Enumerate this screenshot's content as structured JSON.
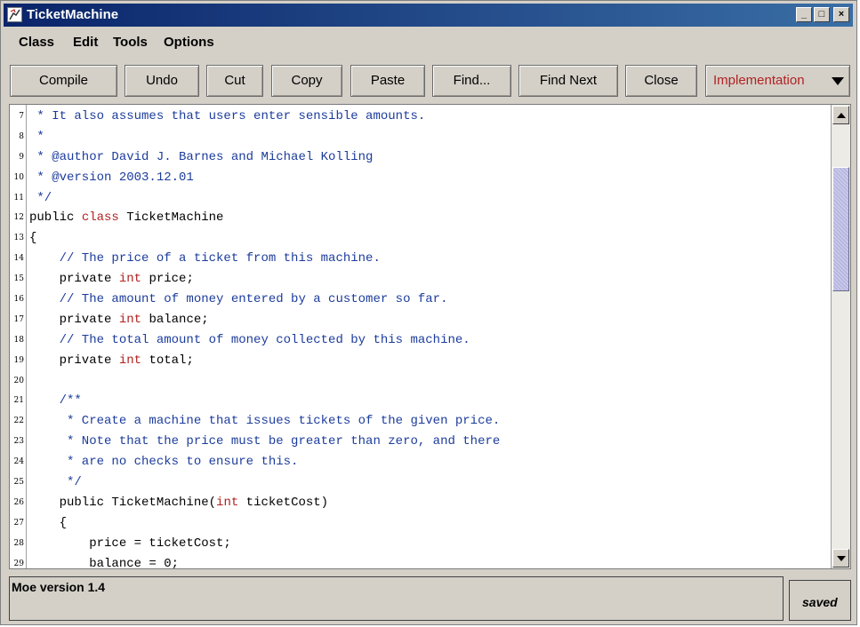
{
  "window": {
    "title": "TicketMachine",
    "controls": {
      "minimize": "_",
      "maximize": "□",
      "close": "×"
    }
  },
  "menubar": {
    "items": [
      "Class",
      "Edit",
      "Tools",
      "Options"
    ]
  },
  "toolbar": {
    "buttons": [
      "Compile",
      "Undo",
      "Cut",
      "Copy",
      "Paste",
      "Find...",
      "Find Next",
      "Close"
    ],
    "view_select": "Implementation"
  },
  "editor": {
    "lines": [
      {
        "n": "7",
        "segments": [
          {
            "t": "c",
            "v": " * It also assumes that users enter sensible amounts."
          }
        ]
      },
      {
        "n": "8",
        "segments": [
          {
            "t": "c",
            "v": " *"
          }
        ]
      },
      {
        "n": "9",
        "segments": [
          {
            "t": "c",
            "v": " * @author David J. Barnes and Michael Kolling"
          }
        ]
      },
      {
        "n": "10",
        "segments": [
          {
            "t": "c",
            "v": " * @version 2003.12.01"
          }
        ]
      },
      {
        "n": "11",
        "segments": [
          {
            "t": "c",
            "v": " */"
          }
        ]
      },
      {
        "n": "12",
        "segments": [
          {
            "t": "t",
            "v": "public "
          },
          {
            "t": "k",
            "v": "class"
          },
          {
            "t": "t",
            "v": " TicketMachine"
          }
        ]
      },
      {
        "n": "13",
        "segments": [
          {
            "t": "t",
            "v": "{"
          }
        ]
      },
      {
        "n": "14",
        "segments": [
          {
            "t": "c",
            "v": "    // The price of a ticket from this machine."
          }
        ]
      },
      {
        "n": "15",
        "segments": [
          {
            "t": "t",
            "v": "    private "
          },
          {
            "t": "k",
            "v": "int"
          },
          {
            "t": "t",
            "v": " price;"
          }
        ]
      },
      {
        "n": "16",
        "segments": [
          {
            "t": "c",
            "v": "    // The amount of money entered by a customer so far."
          }
        ]
      },
      {
        "n": "17",
        "segments": [
          {
            "t": "t",
            "v": "    private "
          },
          {
            "t": "k",
            "v": "int"
          },
          {
            "t": "t",
            "v": " balance;"
          }
        ]
      },
      {
        "n": "18",
        "segments": [
          {
            "t": "c",
            "v": "    // The total amount of money collected by this machine."
          }
        ]
      },
      {
        "n": "19",
        "segments": [
          {
            "t": "t",
            "v": "    private "
          },
          {
            "t": "k",
            "v": "int"
          },
          {
            "t": "t",
            "v": " total;"
          }
        ]
      },
      {
        "n": "20",
        "segments": [
          {
            "t": "t",
            "v": ""
          }
        ]
      },
      {
        "n": "21",
        "segments": [
          {
            "t": "c",
            "v": "    /**"
          }
        ]
      },
      {
        "n": "22",
        "segments": [
          {
            "t": "c",
            "v": "     * Create a machine that issues tickets of the given price."
          }
        ]
      },
      {
        "n": "23",
        "segments": [
          {
            "t": "c",
            "v": "     * Note that the price must be greater than zero, and there"
          }
        ]
      },
      {
        "n": "24",
        "segments": [
          {
            "t": "c",
            "v": "     * are no checks to ensure this."
          }
        ]
      },
      {
        "n": "25",
        "segments": [
          {
            "t": "c",
            "v": "     */"
          }
        ]
      },
      {
        "n": "26",
        "segments": [
          {
            "t": "t",
            "v": "    public TicketMachine("
          },
          {
            "t": "k",
            "v": "int"
          },
          {
            "t": "t",
            "v": " ticketCost)"
          }
        ]
      },
      {
        "n": "27",
        "segments": [
          {
            "t": "t",
            "v": "    {"
          }
        ]
      },
      {
        "n": "28",
        "segments": [
          {
            "t": "t",
            "v": "        price = ticketCost;"
          }
        ]
      },
      {
        "n": "29",
        "segments": [
          {
            "t": "t",
            "v": "        balance = 0;"
          }
        ]
      }
    ],
    "scroll_position": 0.14
  },
  "status": {
    "message": "Moe version 1.4",
    "saved": "saved"
  }
}
